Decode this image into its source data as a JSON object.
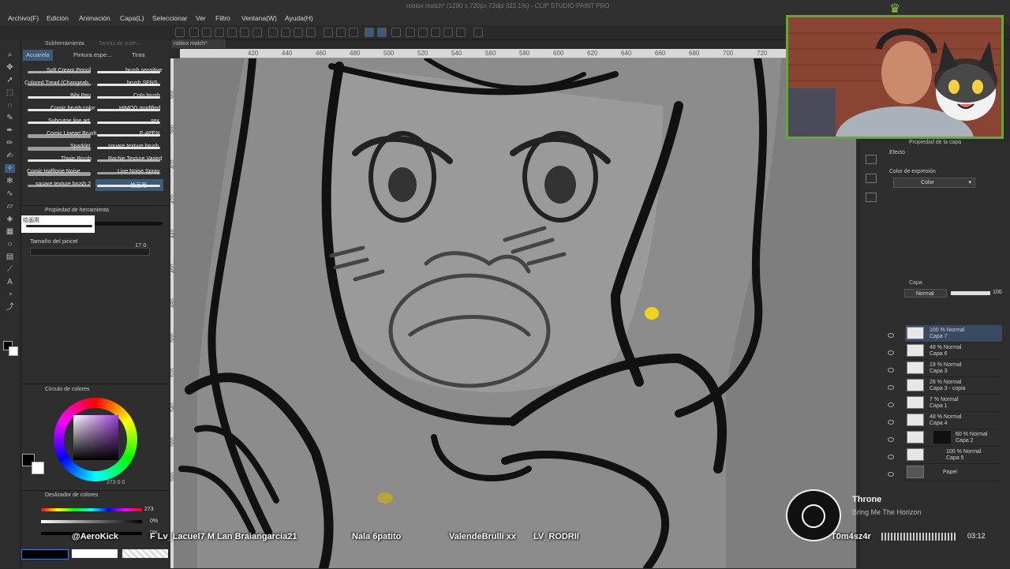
{
  "window": {
    "title": "roblox match* (1280 x 720px 72dpi 322.1%) - CLIP STUDIO PAINT PRO"
  },
  "menu": [
    "Archivo(F)",
    "Edición",
    "Animación",
    "Capa(L)",
    "Seleccionar",
    "Ver",
    "Filtro",
    "Ventana(W)",
    "Ayuda(H)"
  ],
  "subtool_panel": {
    "top_tabs": [
      "Subherramienta",
      "Tareas de subh..."
    ],
    "tabs": [
      "Acuarela",
      "Pintura espe...",
      "Tinta"
    ],
    "brushes_left": [
      "Soft Cream Pencil",
      "Colored Tread (Changeab...",
      "Bibi Pen",
      "Comic brush color",
      "Subcutoe line art",
      "Comic Lineart Brush",
      "Sparkle!",
      "Thwip Brush",
      "Comic Halftone Noise",
      "square texture brush 2"
    ],
    "brushes_right": [
      "brush sensitive",
      "brush SENS",
      "Colo brush",
      "HIMOG modified",
      "sex",
      "E-4PEN",
      "square texture brush",
      "Rachie Texture Varied",
      "Line Noise Spray",
      "绘画用"
    ]
  },
  "tool_property": {
    "title": "Propiedad de herramienta",
    "brush_name": "绘画用",
    "size_label": "Tamaño del pincel",
    "size_value": "17.0"
  },
  "color_panel": {
    "title": "Círculo de colores",
    "values": "273  0  0"
  },
  "color_slider": {
    "title": "Deslizador de colores",
    "h_value": "273",
    "s_value": "0%",
    "v_value": "0%"
  },
  "canvas": {
    "tab_label": "roblox match*",
    "ruler_ticks": [
      "420",
      "440",
      "460",
      "480",
      "500",
      "520",
      "540",
      "560",
      "580",
      "600",
      "620",
      "640",
      "660",
      "680",
      "700",
      "720"
    ],
    "vruler_ticks": [
      "360",
      "380",
      "400",
      "420",
      "440",
      "460",
      "480",
      "500",
      "520",
      "540",
      "560",
      "580"
    ]
  },
  "layer_property": {
    "title": "Propiedad de la capa",
    "effect_label": "Efecto",
    "expression_label": "Color de expresión",
    "expression_value": "Color"
  },
  "layers": {
    "title": "Capa",
    "blend_mode": "Normal",
    "opacity": "100",
    "items": [
      {
        "pct": "100 % Normal",
        "name": "Capa 7"
      },
      {
        "pct": "48 % Normal",
        "name": "Capa 6"
      },
      {
        "pct": "19 % Normal",
        "name": "Capa 3"
      },
      {
        "pct": "28 % Normal",
        "name": "Capa 3 - copia"
      },
      {
        "pct": "7 % Normal",
        "name": "Capa 1"
      },
      {
        "pct": "48 % Normal",
        "name": "Capa 4"
      },
      {
        "pct": "60 % Normal",
        "name": "Capa 2"
      },
      {
        "pct": "100 % Normal",
        "name": "Capa 5"
      },
      {
        "pct": "",
        "name": "Papel"
      }
    ]
  },
  "stream_overlay": {
    "chat_names": [
      "@AeroKick",
      "F Lv_Lacuel7 M Lan Braiangarcia21",
      "Nala 6patito",
      "ValendeBrulli xx",
      "LV_RODRII",
      "T0m4sz4r"
    ],
    "music": {
      "artist": "Throne",
      "title": "Bring Me The Horizon",
      "time": "03:12"
    }
  },
  "colors": {
    "accent_green": "#5fae2b",
    "selected_layer": "#3b4a63",
    "active_tab": "#3d5a7a"
  }
}
